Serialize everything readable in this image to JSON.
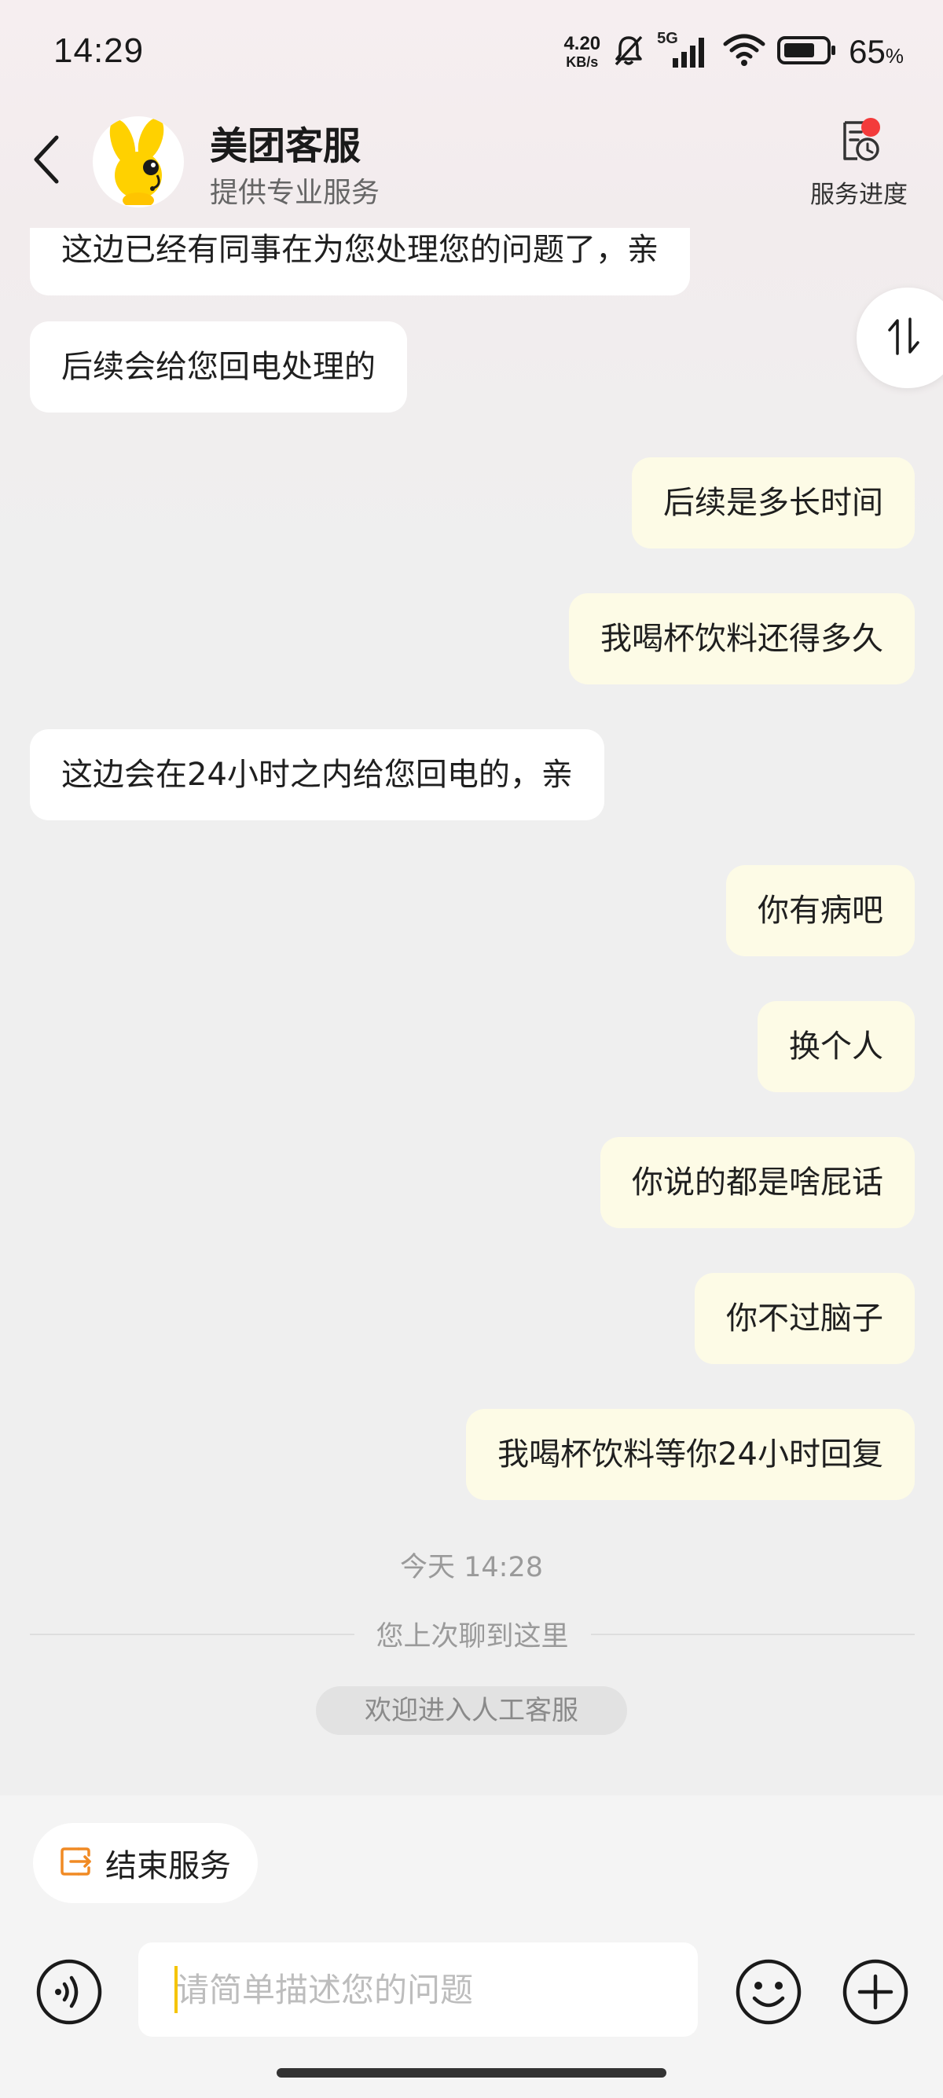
{
  "status_bar": {
    "time": "14:29",
    "net_speed_value": "4.20",
    "net_speed_unit": "KB/s",
    "network_type": "5G",
    "battery_percent": "65",
    "battery_symbol": "%"
  },
  "header": {
    "back_icon": "chevron-left-icon",
    "title": "美团客服",
    "subtitle": "提供专业服务",
    "progress_label": "服务进度",
    "notification_dot_color": "#f33b3b"
  },
  "messages": [
    {
      "side": "left",
      "text": "这边已经有同事在为您处理您的问题了，亲"
    },
    {
      "side": "left",
      "text": "后续会给您回电处理的"
    },
    {
      "side": "right",
      "text": "后续是多长时间"
    },
    {
      "side": "right",
      "text": "我喝杯饮料还得多久"
    },
    {
      "side": "left",
      "text": "这边会在24小时之内给您回电的，亲"
    },
    {
      "side": "right",
      "text": "你有病吧"
    },
    {
      "side": "right",
      "text": "换个人"
    },
    {
      "side": "right",
      "text": "你说的都是啥屁话"
    },
    {
      "side": "right",
      "text": "你不过脑子"
    },
    {
      "side": "right",
      "text": "我喝杯饮料等你24小时回复"
    }
  ],
  "system": {
    "timestamp": "今天 14:28",
    "last_seen_divider": "您上次聊到这里",
    "welcome": "欢迎进入人工客服"
  },
  "bottom": {
    "end_service_label": "结束服务",
    "input_placeholder": "请简单描述您的问题",
    "input_value": ""
  },
  "colors": {
    "user_bubble": "#fdfbe6",
    "agent_bubble": "#ffffff",
    "accent_orange": "#f08a24",
    "cursor_yellow": "#f5c400"
  }
}
